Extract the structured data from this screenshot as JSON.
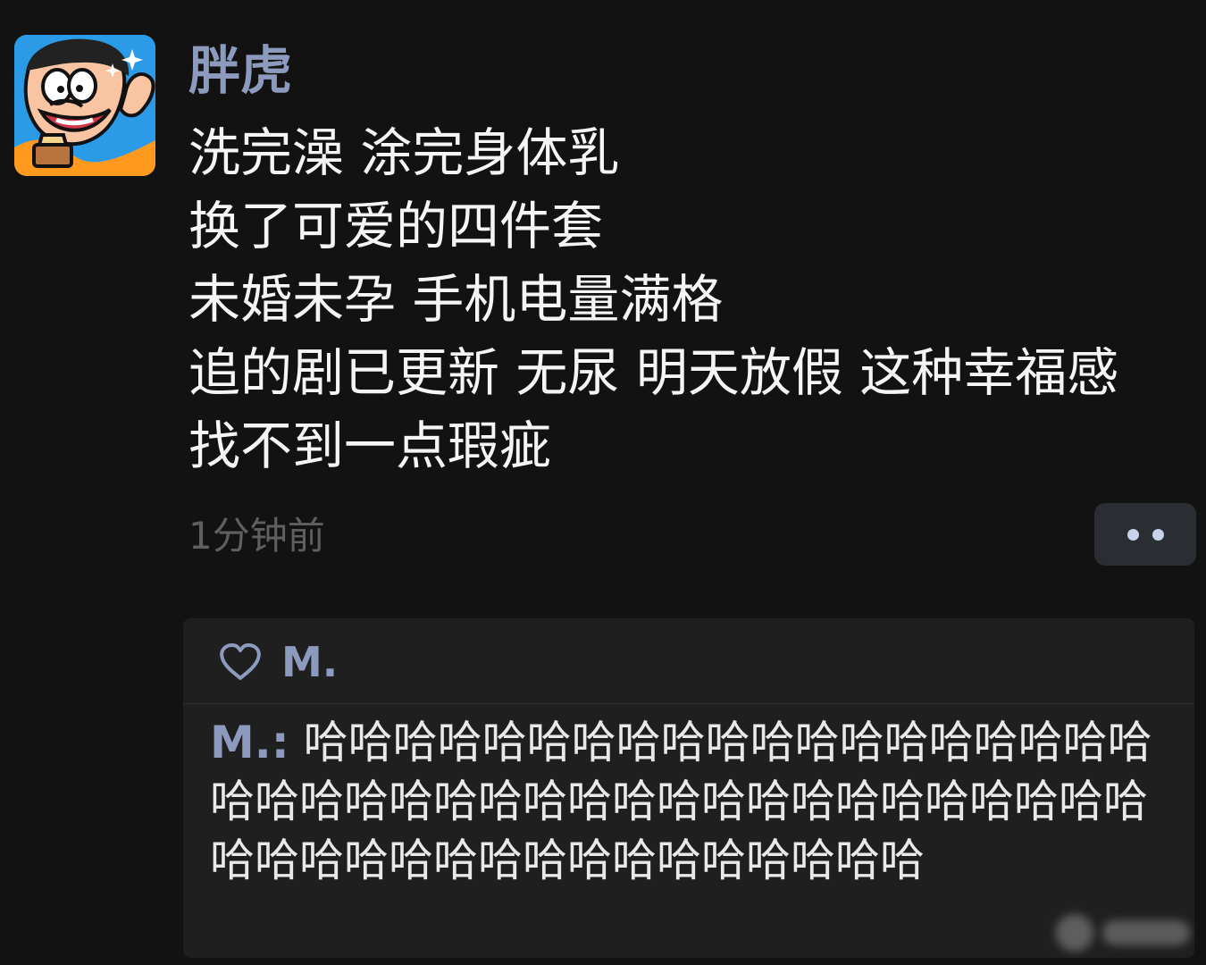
{
  "post": {
    "author_name": "胖虎",
    "content": "洗完澡 涂完身体乳\n换了可爱的四件套\n未婚未孕 手机电量满格\n追的剧已更新 无尿 明天放假 这种幸福感\n找不到一点瑕疵",
    "timestamp": "1分钟前",
    "more_icon": "ellipsis-icon"
  },
  "likes": {
    "icon": "heart-icon",
    "name": "M."
  },
  "comment": {
    "author": "M.:",
    "text": " 哈哈哈哈哈哈哈哈哈哈哈哈哈哈哈哈哈哈哈哈哈哈哈哈哈哈哈哈哈哈哈哈哈哈哈哈哈哈哈哈哈哈哈哈哈哈哈哈哈哈哈哈哈哈哈哈"
  },
  "colors": {
    "background": "#121212",
    "panel": "#1f1f1f",
    "accent": "#8c9bbd",
    "text": "#f5f5f5",
    "muted": "#5f5f5f"
  }
}
